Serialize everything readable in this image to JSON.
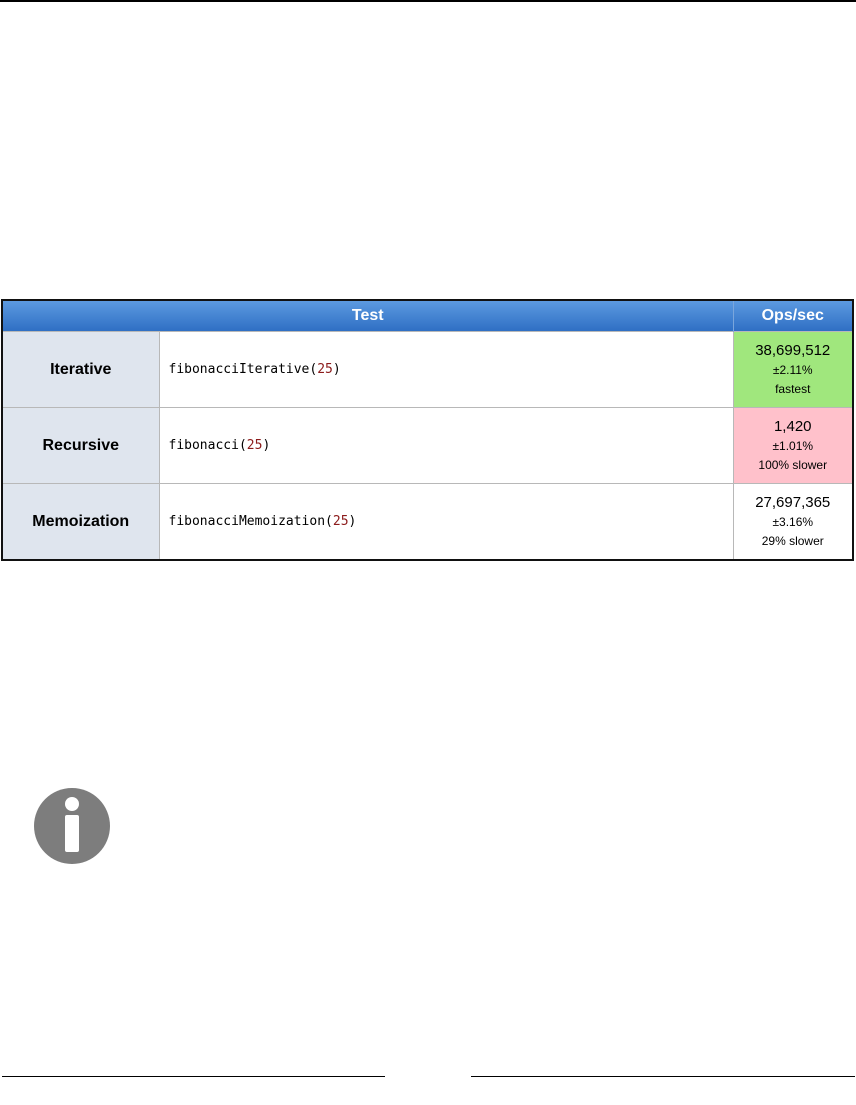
{
  "table": {
    "headers": {
      "test": "Test",
      "ops": "Ops/sec"
    },
    "rows": [
      {
        "name": "Iterative",
        "code_fn": "fibonacciIterative(",
        "code_arg": "25",
        "code_close": ")",
        "ops": "38,699,512",
        "error": "±2.11%",
        "relative": "fastest",
        "status_color": "#a0e77d"
      },
      {
        "name": "Recursive",
        "code_fn": "fibonacci(",
        "code_arg": "25",
        "code_close": ")",
        "ops": "1,420",
        "error": "±1.01%",
        "relative": "100% slower",
        "status_color": "#ffc1cb"
      },
      {
        "name": "Memoization",
        "code_fn": "fibonacciMemoization(",
        "code_arg": "25",
        "code_close": ")",
        "ops": "27,697,365",
        "error": "±3.16%",
        "relative": "29% slower",
        "status_color": "#ffffff"
      }
    ]
  },
  "icons": {
    "info": "info-icon"
  }
}
